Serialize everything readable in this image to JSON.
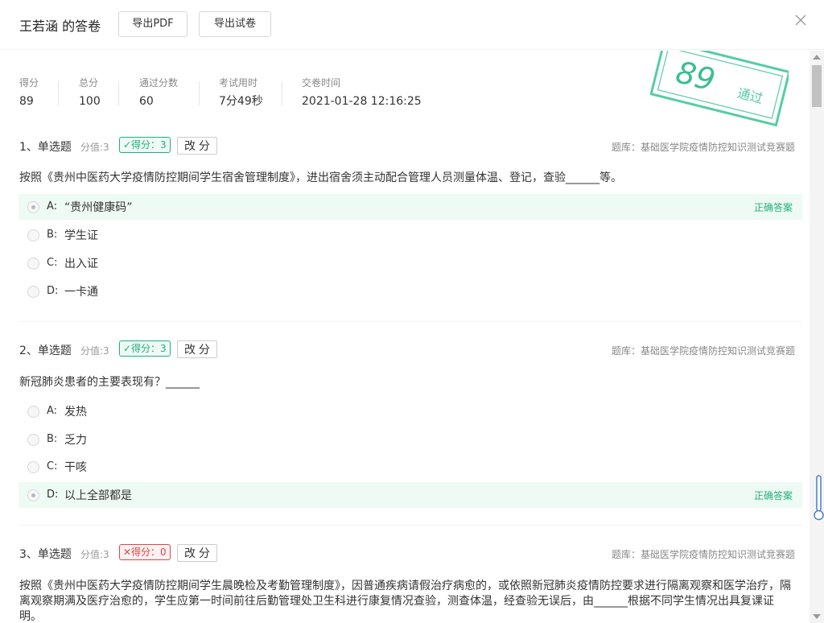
{
  "header": {
    "title": "王若涵 的答卷",
    "export_pdf": "导出PDF",
    "export_paper": "导出试卷"
  },
  "stats": [
    {
      "label": "得分",
      "value": "89"
    },
    {
      "label": "总分",
      "value": "100"
    },
    {
      "label": "通过分数",
      "value": "60"
    },
    {
      "label": "考试用时",
      "value": "7分49秒"
    },
    {
      "label": "交卷时间",
      "value": "2021-01-28 12:16:25"
    }
  ],
  "stamp": {
    "score": "89",
    "status": "通过"
  },
  "questions": [
    {
      "no": "1、单选题",
      "score_label": "分值:3",
      "badge": "✓得分：3",
      "regrade": "改 分",
      "bank": "题库：基础医学院疫情防控知识测试竞赛题",
      "text": "按照《贵州中医药大学疫情防控期间学生宿舍管理制度》，进出宿舍须主动配合管理人员测量体温、登记，查验______等。",
      "options": [
        {
          "letter": "A:",
          "text": "“贵州健康码”",
          "correct_tag": "正确答案"
        },
        {
          "letter": "B:",
          "text": "学生证"
        },
        {
          "letter": "C:",
          "text": "出入证"
        },
        {
          "letter": "D:",
          "text": "一卡通"
        }
      ]
    },
    {
      "no": "2、单选题",
      "score_label": "分值:3",
      "badge": "✓得分：3",
      "regrade": "改 分",
      "bank": "题库：基础医学院疫情防控知识测试竞赛题",
      "text": "新冠肺炎患者的主要表现有？______",
      "options": [
        {
          "letter": "A:",
          "text": "发热"
        },
        {
          "letter": "B:",
          "text": "乏力"
        },
        {
          "letter": "C:",
          "text": "干咳"
        },
        {
          "letter": "D:",
          "text": "以上全部都是",
          "correct_tag": "正确答案"
        }
      ]
    },
    {
      "no": "3、单选题",
      "score_label": "分值:3",
      "badge": "✕得分：0",
      "regrade": "改 分",
      "bank": "题库：基础医学院疫情防控知识测试竞赛题",
      "text": "按照《贵州中医药大学疫情防控期间学生晨晚检及考勤管理制度》，因普通疾病请假治疗病愈的，或依照新冠肺炎疫情防控要求进行隔离观察和医学治疗，隔离观察期满及医疗治愈的，学生应第一时间前往后勤管理处卫生科进行康复情况查验，测查体温，经查验无误后，由______根据不同学生情况出具复课证明。"
    }
  ]
}
